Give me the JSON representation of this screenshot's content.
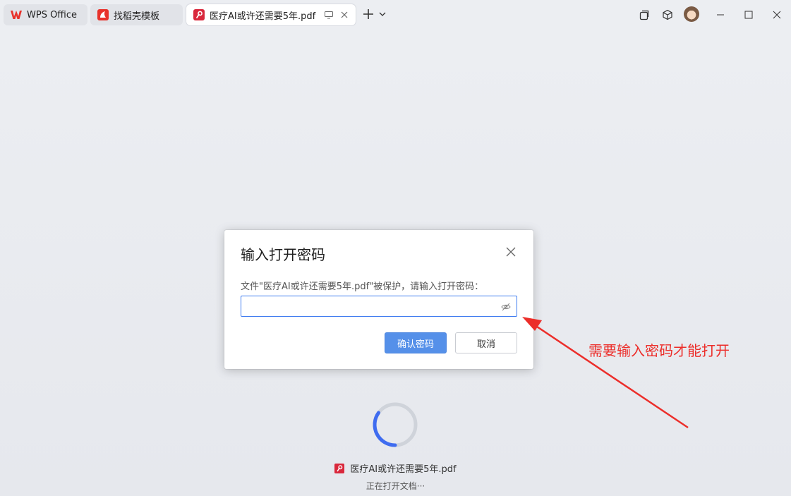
{
  "tabs": [
    {
      "label": "WPS Office",
      "icon": "wps-logo-icon"
    },
    {
      "label": "找稻壳模板",
      "icon": "docer-icon"
    },
    {
      "label": "医疗AI或许还需要5年.pdf",
      "icon": "pdf-icon",
      "active": true
    }
  ],
  "dialog": {
    "title": "输入打开密码",
    "message": "文件\"医疗AI或许还需要5年.pdf\"被保护，请输入打开密码：",
    "password_value": "",
    "confirm_label": "确认密码",
    "cancel_label": "取消"
  },
  "annotation": {
    "text": "需要输入密码才能打开",
    "color": "#ec2e2a"
  },
  "loading": {
    "file_name": "医疗AI或许还需要5年.pdf",
    "status": "正在打开文档···"
  },
  "colors": {
    "accent": "#5590e9",
    "spinner": "#3f6cf0",
    "pdf_red": "#d9283c"
  }
}
